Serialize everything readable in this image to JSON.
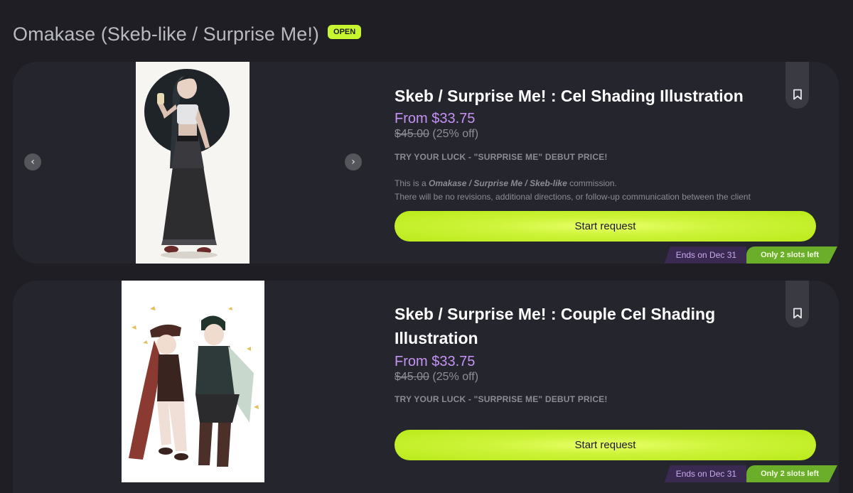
{
  "section": {
    "title": "Omakase (Skeb-like / Surprise Me!)",
    "status_badge": "OPEN"
  },
  "carousel": {
    "prev_icon": "‹",
    "next_icon": "›"
  },
  "items": [
    {
      "title": "Skeb / Surprise Me! : Cel Shading Illustration",
      "price": "From $33.75",
      "old_price": "$45.00",
      "discount": "(25% off)",
      "tagline": "TRY YOUR LUCK - \"SURPRISE ME\" DEBUT PRICE!",
      "desc_prefix": "This is a ",
      "desc_emph": "Omakase / Surprise Me / Skeb-like",
      "desc_suffix": " commission.",
      "desc_line2": "There will be no revisions, additional directions, or follow-up communication between the client",
      "button": "Start request",
      "ends": "Ends on Dec 31",
      "slots": "Only 2 slots left"
    },
    {
      "title": "Skeb / Surprise Me! : Couple Cel Shading Illustration",
      "price": "From $33.75",
      "old_price": "$45.00",
      "discount": "(25% off)",
      "tagline": "TRY YOUR LUCK - \"SURPRISE ME\" DEBUT PRICE!",
      "button": "Start request",
      "ends": "Ends on Dec 31",
      "slots": "Only 2 slots left"
    }
  ],
  "colors": {
    "background": "#1e1e24",
    "card": "#25252d",
    "accent_green": "#c7f52f",
    "price_purple": "#c693f5"
  },
  "icons": {
    "bookmark": "bookmark-icon",
    "prev": "chevron-left-icon",
    "next": "chevron-right-icon"
  }
}
